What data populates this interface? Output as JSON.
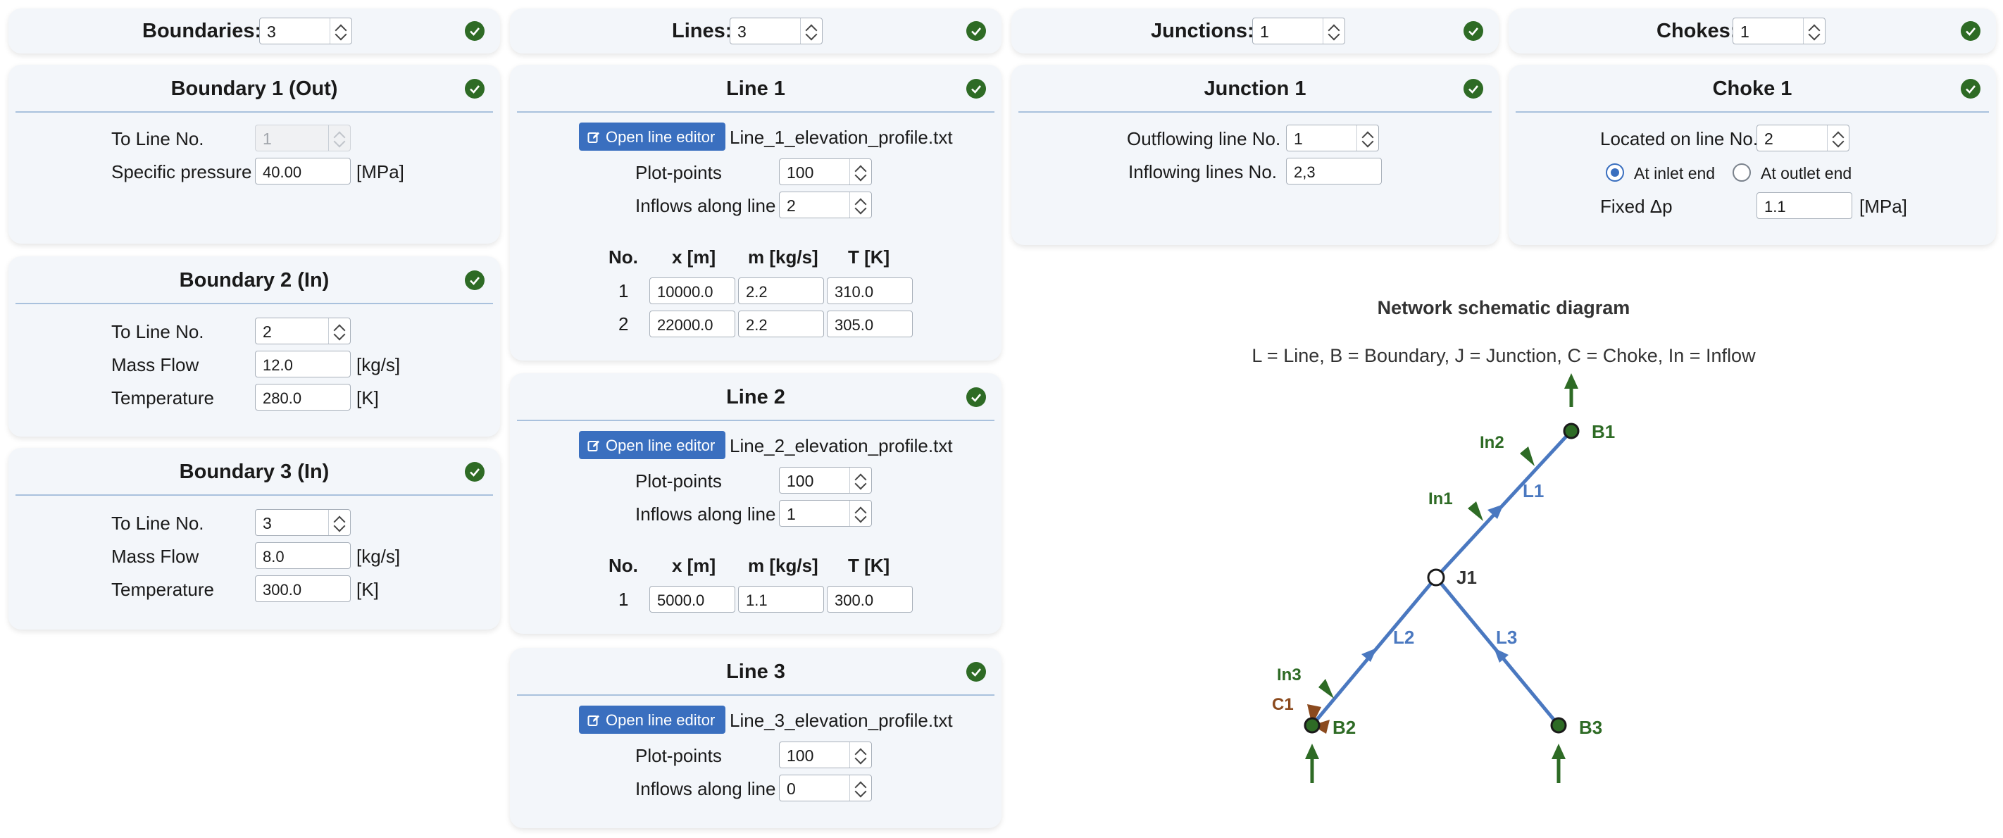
{
  "colors": {
    "check_green": "#2e6b25",
    "accent_blue": "#3a6fbf",
    "diagram_line": "#4a78c0",
    "diagram_green": "#2e6b25",
    "choke_brown": "#8b4a1e"
  },
  "counts": {
    "boundaries": {
      "label": "Boundaries:",
      "value": "3"
    },
    "lines": {
      "label": "Lines:",
      "value": "3"
    },
    "junctions": {
      "label": "Junctions:",
      "value": "1"
    },
    "chokes": {
      "label": "Chokes:",
      "value": "1"
    }
  },
  "boundary1": {
    "title": "Boundary 1 (Out)",
    "to_line_label": "To Line No.",
    "to_line_value": "1",
    "pressure_label": "Specific pressure",
    "pressure_value": "40.00",
    "pressure_unit": "[MPa]"
  },
  "boundary2": {
    "title": "Boundary 2 (In)",
    "to_line_label": "To Line No.",
    "to_line_value": "2",
    "mass_label": "Mass Flow",
    "mass_value": "12.0",
    "mass_unit": "[kg/s]",
    "temp_label": "Temperature",
    "temp_value": "280.0",
    "temp_unit": "[K]"
  },
  "boundary3": {
    "title": "Boundary 3 (In)",
    "to_line_label": "To Line No.",
    "to_line_value": "3",
    "mass_label": "Mass Flow",
    "mass_value": "8.0",
    "mass_unit": "[kg/s]",
    "temp_label": "Temperature",
    "temp_value": "300.0",
    "temp_unit": "[K]"
  },
  "line_common": {
    "editor_button": "Open line editor",
    "plot_points_label": "Plot-points",
    "inflows_label": "Inflows along line",
    "col_no": "No.",
    "col_x": "x [m]",
    "col_m": "m [kg/s]",
    "col_t": "T [K]"
  },
  "line1": {
    "title": "Line 1",
    "file": "Line_1_elevation_profile.txt",
    "plot_points": "100",
    "inflows": "2",
    "rows": [
      {
        "no": "1",
        "x": "10000.0",
        "m": "2.2",
        "t": "310.0"
      },
      {
        "no": "2",
        "x": "22000.0",
        "m": "2.2",
        "t": "305.0"
      }
    ]
  },
  "line2": {
    "title": "Line 2",
    "file": "Line_2_elevation_profile.txt",
    "plot_points": "100",
    "inflows": "1",
    "rows": [
      {
        "no": "1",
        "x": "5000.0",
        "m": "1.1",
        "t": "300.0"
      }
    ]
  },
  "line3": {
    "title": "Line 3",
    "file": "Line_3_elevation_profile.txt",
    "plot_points": "100",
    "inflows": "0"
  },
  "junction1": {
    "title": "Junction 1",
    "out_label": "Outflowing line No.",
    "out_value": "1",
    "in_label": "Inflowing lines No.",
    "in_value": "2,3"
  },
  "choke1": {
    "title": "Choke 1",
    "located_label": "Located on line No.",
    "located_value": "2",
    "inlet_label": "At inlet end",
    "outlet_label": "At outlet end",
    "selected": "inlet",
    "dp_label": "Fixed Δp",
    "dp_value": "1.1",
    "dp_unit": "[MPa]"
  },
  "diagram": {
    "title": "Network schematic diagram",
    "legend": "L = Line, B = Boundary, J = Junction, C = Choke, In = Inflow",
    "labels": {
      "B1": "B1",
      "B2": "B2",
      "B3": "B3",
      "J1": "J1",
      "L1": "L1",
      "L2": "L2",
      "L3": "L3",
      "In1": "In1",
      "In2": "In2",
      "In3": "In3",
      "C1": "C1"
    }
  }
}
